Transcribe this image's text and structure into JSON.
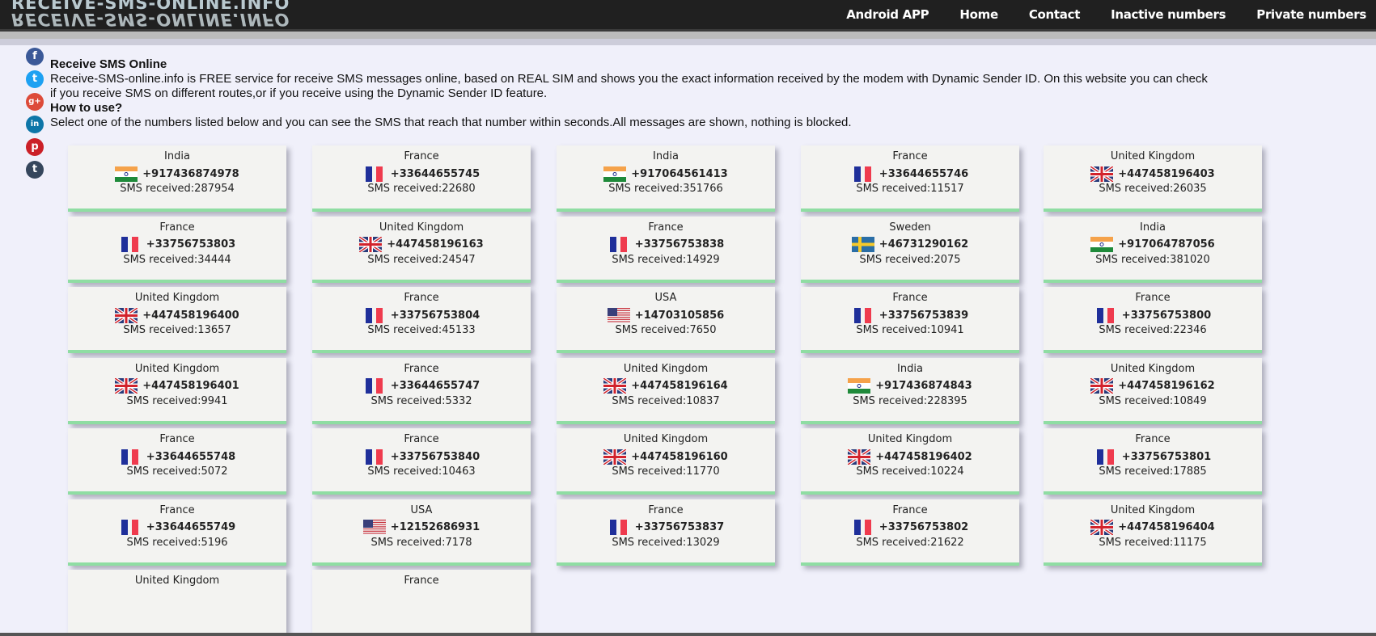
{
  "site": {
    "logo": "RECEIVE-SMS-ONLINE.INFO",
    "nav": [
      "Android APP",
      "Home",
      "Contact",
      "Inactive numbers",
      "Private numbers"
    ]
  },
  "social": [
    {
      "name": "facebook",
      "glyph": "f",
      "color": "#3b5998"
    },
    {
      "name": "twitter",
      "glyph": "t",
      "color": "#1da1f2"
    },
    {
      "name": "google-plus",
      "glyph": "g+",
      "color": "#dd4b39"
    },
    {
      "name": "linkedin",
      "glyph": "in",
      "color": "#0e76a8"
    },
    {
      "name": "pinterest",
      "glyph": "p",
      "color": "#cb2027"
    },
    {
      "name": "tumblr",
      "glyph": "t",
      "color": "#35465c"
    }
  ],
  "intro": {
    "title": "Receive SMS Online",
    "line1": "Receive-SMS-online.info is FREE service for receive SMS messages online, based on REAL SIM and shows you the exact information received by the modem with Dynamic Sender ID. On this website you can check",
    "line2": "if you receive SMS on different routes,or if you receive using the Dynamic Sender ID feature.",
    "howto_title": "How to use?",
    "howto_text": "Select one of the numbers listed below and you can see the SMS that reach that number within seconds.All messages are shown, nothing is blocked."
  },
  "count_label": "SMS received:",
  "numbers": [
    {
      "country": "India",
      "flag": "in",
      "number": "+917436874978",
      "received": "287954"
    },
    {
      "country": "France",
      "flag": "fr",
      "number": "+33644655745",
      "received": "22680"
    },
    {
      "country": "India",
      "flag": "in",
      "number": "+917064561413",
      "received": "351766"
    },
    {
      "country": "France",
      "flag": "fr",
      "number": "+33644655746",
      "received": "11517"
    },
    {
      "country": "United Kingdom",
      "flag": "gb",
      "number": "+447458196403",
      "received": "26035"
    },
    {
      "country": "France",
      "flag": "fr",
      "number": "+33756753803",
      "received": "34444"
    },
    {
      "country": "United Kingdom",
      "flag": "gb",
      "number": "+447458196163",
      "received": "24547"
    },
    {
      "country": "France",
      "flag": "fr",
      "number": "+33756753838",
      "received": "14929"
    },
    {
      "country": "Sweden",
      "flag": "se",
      "number": "+46731290162",
      "received": "2075"
    },
    {
      "country": "India",
      "flag": "in",
      "number": "+917064787056",
      "received": "381020"
    },
    {
      "country": "United Kingdom",
      "flag": "gb",
      "number": "+447458196400",
      "received": "13657"
    },
    {
      "country": "France",
      "flag": "fr",
      "number": "+33756753804",
      "received": "45133"
    },
    {
      "country": "USA",
      "flag": "us",
      "number": "+14703105856",
      "received": "7650"
    },
    {
      "country": "France",
      "flag": "fr",
      "number": "+33756753839",
      "received": "10941"
    },
    {
      "country": "France",
      "flag": "fr",
      "number": "+33756753800",
      "received": "22346"
    },
    {
      "country": "United Kingdom",
      "flag": "gb",
      "number": "+447458196401",
      "received": "9941"
    },
    {
      "country": "France",
      "flag": "fr",
      "number": "+33644655747",
      "received": "5332"
    },
    {
      "country": "United Kingdom",
      "flag": "gb",
      "number": "+447458196164",
      "received": "10837"
    },
    {
      "country": "India",
      "flag": "in",
      "number": "+917436874843",
      "received": "228395"
    },
    {
      "country": "United Kingdom",
      "flag": "gb",
      "number": "+447458196162",
      "received": "10849"
    },
    {
      "country": "France",
      "flag": "fr",
      "number": "+33644655748",
      "received": "5072"
    },
    {
      "country": "France",
      "flag": "fr",
      "number": "+33756753840",
      "received": "10463"
    },
    {
      "country": "United Kingdom",
      "flag": "gb",
      "number": "+447458196160",
      "received": "11770"
    },
    {
      "country": "United Kingdom",
      "flag": "gb",
      "number": "+447458196402",
      "received": "10224"
    },
    {
      "country": "France",
      "flag": "fr",
      "number": "+33756753801",
      "received": "17885"
    },
    {
      "country": "France",
      "flag": "fr",
      "number": "+33644655749",
      "received": "5196"
    },
    {
      "country": "USA",
      "flag": "us",
      "number": "+12152686931",
      "received": "7178"
    },
    {
      "country": "France",
      "flag": "fr",
      "number": "+33756753837",
      "received": "13029"
    },
    {
      "country": "France",
      "flag": "fr",
      "number": "+33756753802",
      "received": "21622"
    },
    {
      "country": "United Kingdom",
      "flag": "gb",
      "number": "+447458196404",
      "received": "11175"
    },
    {
      "country": "United Kingdom",
      "flag": "gb",
      "number": "",
      "received": ""
    },
    {
      "country": "France",
      "flag": "fr",
      "number": "",
      "received": ""
    }
  ]
}
